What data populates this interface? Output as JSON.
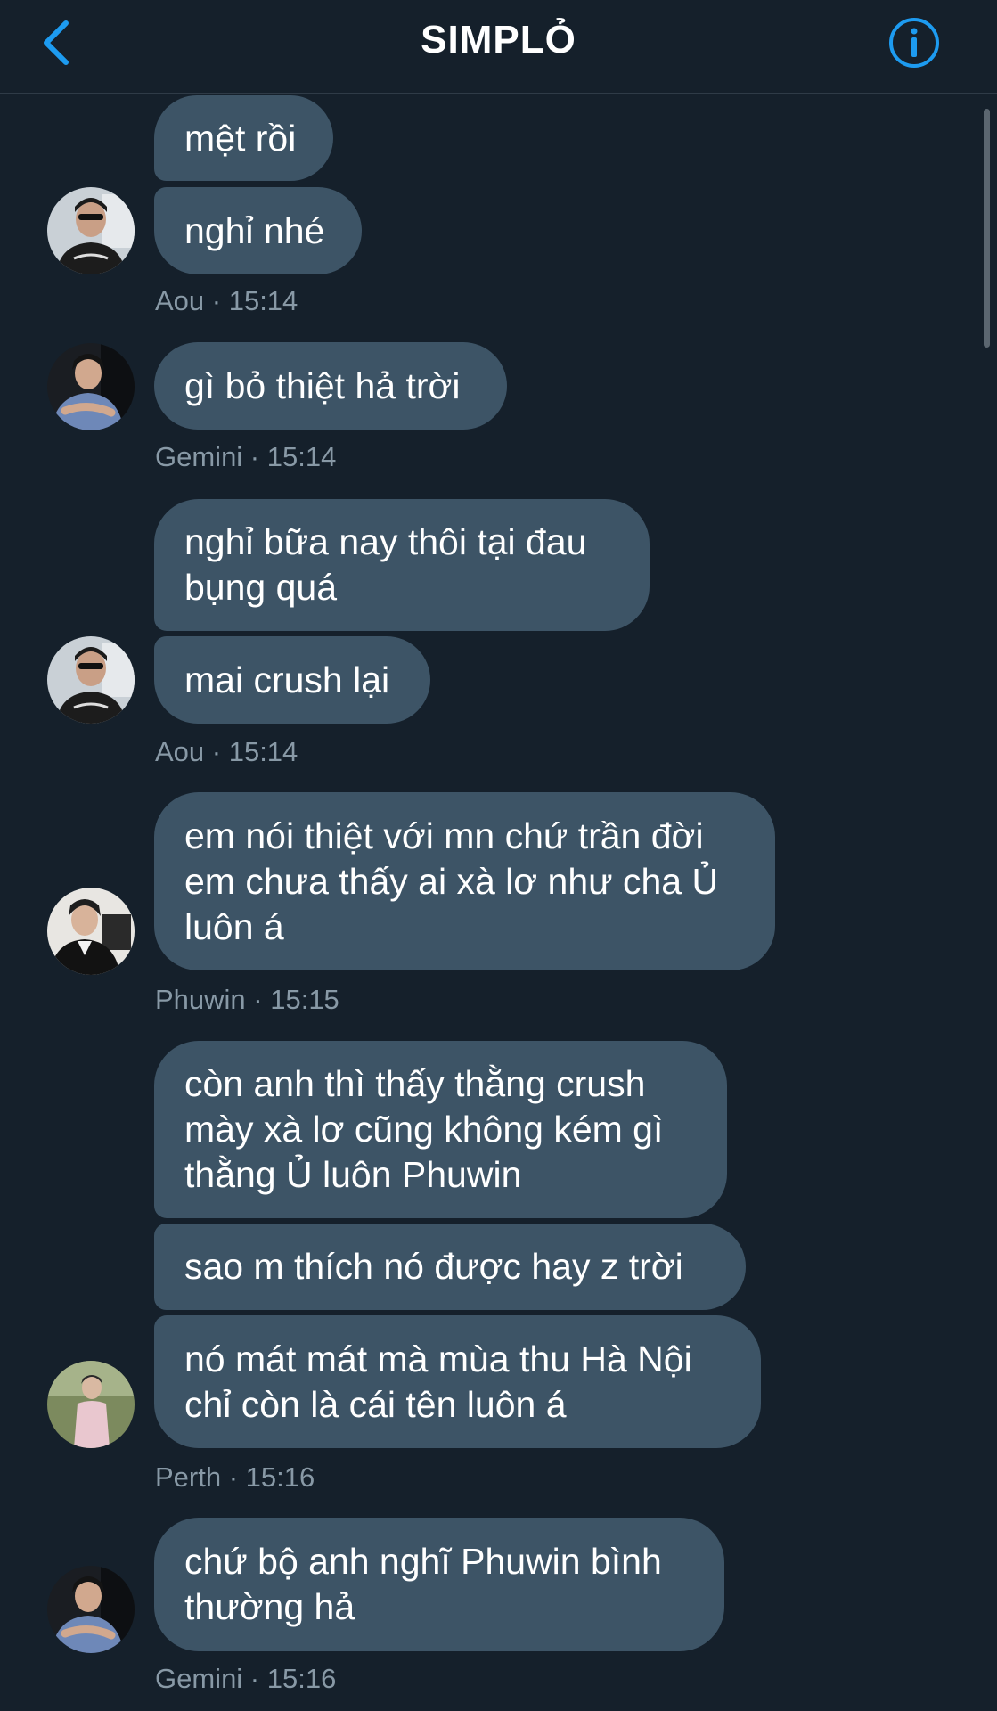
{
  "header": {
    "title": "SIMPLỎ",
    "back_icon": "chevron-left-icon",
    "info_icon": "info-circle-icon",
    "accent": "#1d9bf0"
  },
  "messages": [
    {
      "text": "mệt rồi"
    },
    {
      "text": "nghỉ nhé"
    },
    {
      "meta": "Aou · 15:14"
    },
    {
      "text": "gì bỏ thiệt hả trời"
    },
    {
      "meta": "Gemini · 15:14"
    },
    {
      "text": "nghỉ bữa nay thôi tại đau\nbụng quá"
    },
    {
      "text": "mai crush lại"
    },
    {
      "meta": "Aou · 15:14"
    },
    {
      "text": "em nói thiệt với mn chứ trần đời\nem chưa thấy ai xà lơ như cha Ủ\nluôn á"
    },
    {
      "meta": "Phuwin · 15:15"
    },
    {
      "text": "còn anh thì thấy thằng crush\nmày xà lơ cũng không kém gì\nthằng Ủ luôn Phuwin"
    },
    {
      "text": "sao m thích nó được hay z trời"
    },
    {
      "text": "nó mát mát mà mùa thu Hà Nội\nchỉ còn là cái tên luôn á"
    },
    {
      "meta": "Perth · 15:16"
    },
    {
      "text": "chứ bộ anh nghĩ Phuwin bình\nthường hả"
    },
    {
      "meta": "Gemini · 15:16"
    }
  ],
  "colors": {
    "background": "#15202b",
    "bubble": "#3d5466",
    "meta": "#8899a6"
  }
}
